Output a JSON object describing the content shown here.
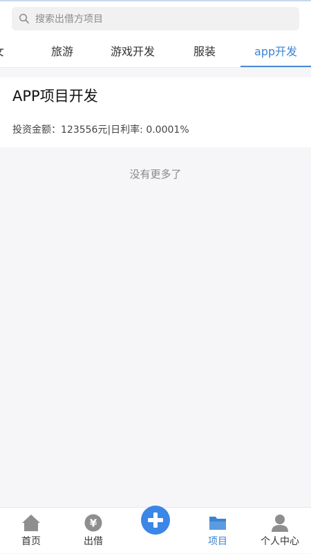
{
  "search": {
    "placeholder": "搜索出借方项目"
  },
  "tabs": [
    {
      "label": "女"
    },
    {
      "label": "旅游"
    },
    {
      "label": "游戏开发"
    },
    {
      "label": "服装"
    },
    {
      "label": "app开发",
      "active": true
    }
  ],
  "project": {
    "title": "APP项目开发",
    "detail": "投资金额：123556元|日利率: 0.0001%"
  },
  "status": {
    "no_more": "没有更多了"
  },
  "bottom_nav": [
    {
      "label": "首页",
      "icon": "home-icon"
    },
    {
      "label": "出借",
      "icon": "yen-coin-icon"
    },
    {
      "label": "",
      "icon": "plus-circle-icon"
    },
    {
      "label": "项目",
      "icon": "folder-icon",
      "active": true
    },
    {
      "label": "个人中心",
      "icon": "user-icon"
    }
  ],
  "colors": {
    "accent": "#3c83d3",
    "add_button": "#3b86e6",
    "inactive_icon": "#8e8e8e",
    "background": "#f6f6f8"
  }
}
